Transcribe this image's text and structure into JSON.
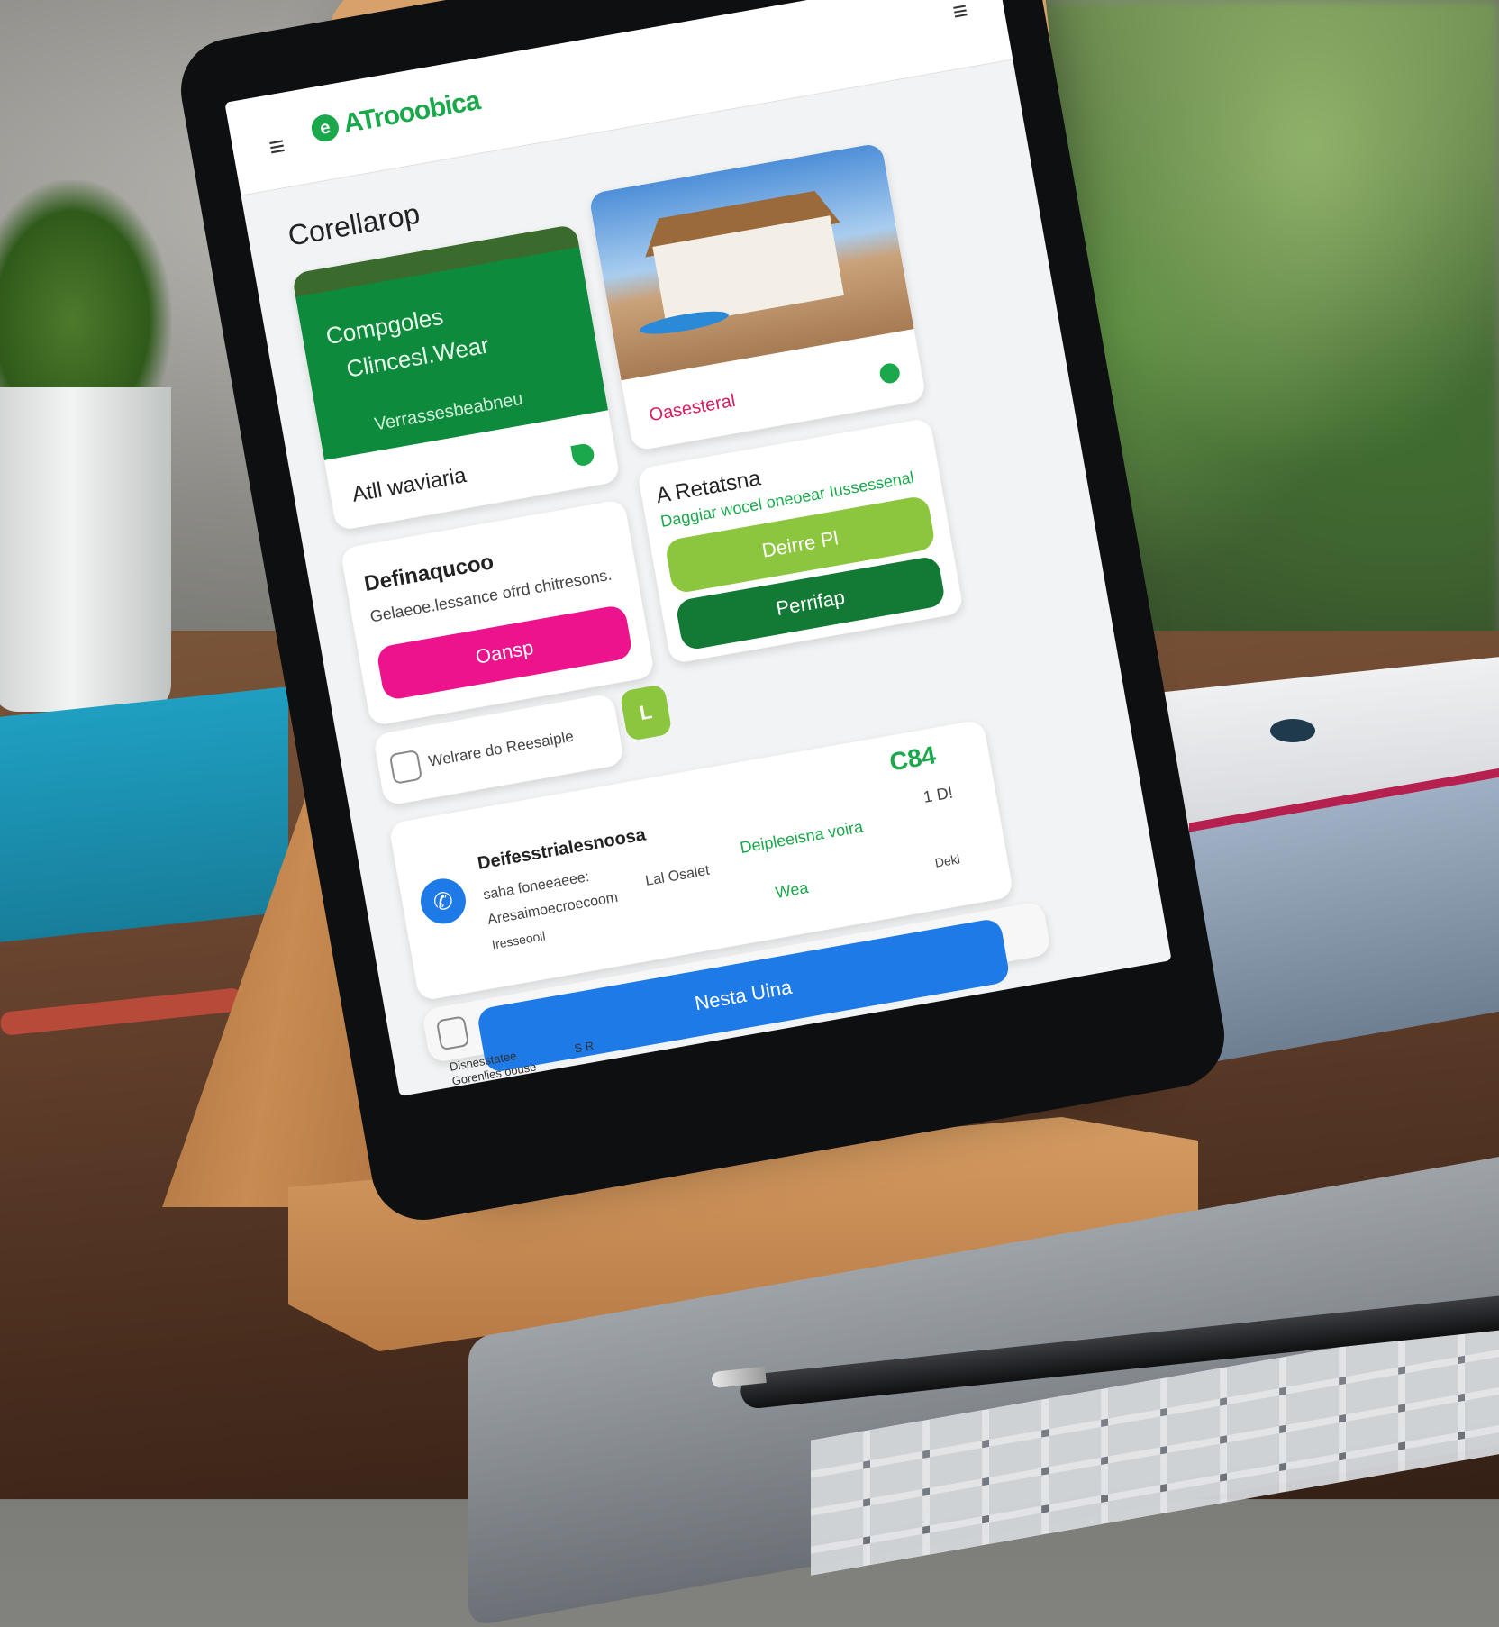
{
  "app": {
    "brand_name": "ATrooobica",
    "brand_logo_letter": "e",
    "menu_icon": "hamburger-icon",
    "page_title": "Corellarop"
  },
  "cards": {
    "green_card": {
      "line1": "Compgoles",
      "line2": "Clincesl.Wear",
      "line3": "Verrassesbeabneu",
      "footer_label": "Atll waviaria",
      "icon": "leaf-icon"
    },
    "photo_card": {
      "footer_label": "Oasesteral",
      "icon": "green-dot-icon"
    },
    "left_info": {
      "title": "Definaqucoo",
      "subtitle": "Gelaeoe.lessance ofrd chitresons.",
      "button": "Oansp"
    },
    "right_info": {
      "title": "A Retatsna",
      "subtitle": "Daggiar wocel oneoear Iussessenal",
      "button_primary": "Deirre Pl",
      "button_secondary": "Perrifap"
    },
    "welcome": {
      "text": "Welrare do Reesaiple",
      "badge": "L"
    },
    "detail": {
      "price": "C84",
      "corner": "1 D!",
      "title": "Deifesstrialesnoosa",
      "line1": "saha foneeaeee:",
      "line2": "Aresaimoecroecoom",
      "line3": "Iresseooil",
      "col2": "Lal Osalet",
      "col3": "Deipleeisna voira",
      "col3b": "Wea",
      "side": "Dekl",
      "phone_icon": "phone-icon"
    },
    "cta": {
      "button": "Nesta Uina"
    },
    "footer": {
      "line1": "Disnesstatee",
      "line2": "Gorenlies oouse",
      "tag": "S R"
    }
  },
  "colors": {
    "brand_green": "#1aa84b",
    "pink": "#ec138d",
    "lime": "#8cc63f",
    "dark_green": "#137a36",
    "blue": "#1e7ae6"
  }
}
